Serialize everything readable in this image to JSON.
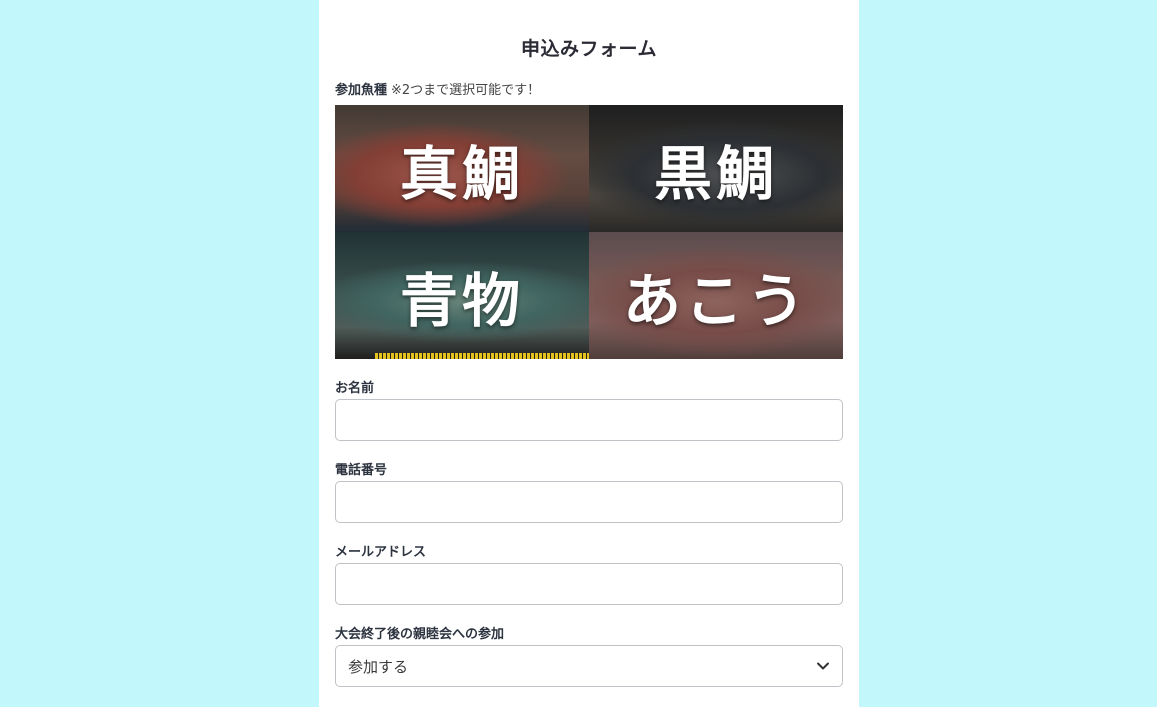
{
  "form": {
    "title": "申込みフォーム"
  },
  "species": {
    "label": "参加魚種",
    "note": "※2つまで選択可能です！",
    "options": [
      {
        "name": "真鯛"
      },
      {
        "name": "黒鯛"
      },
      {
        "name": "青物"
      },
      {
        "name": "あこう"
      }
    ]
  },
  "fields": {
    "name": {
      "label": "お名前",
      "value": ""
    },
    "phone": {
      "label": "電話番号",
      "value": ""
    },
    "email": {
      "label": "メールアドレス",
      "value": ""
    },
    "party": {
      "label": "大会終了後の親睦会への参加",
      "selected": "参加する"
    }
  },
  "colors": {
    "page_background": "#c2f7fb",
    "card_background": "#ffffff",
    "input_border": "#bfc3c8"
  }
}
